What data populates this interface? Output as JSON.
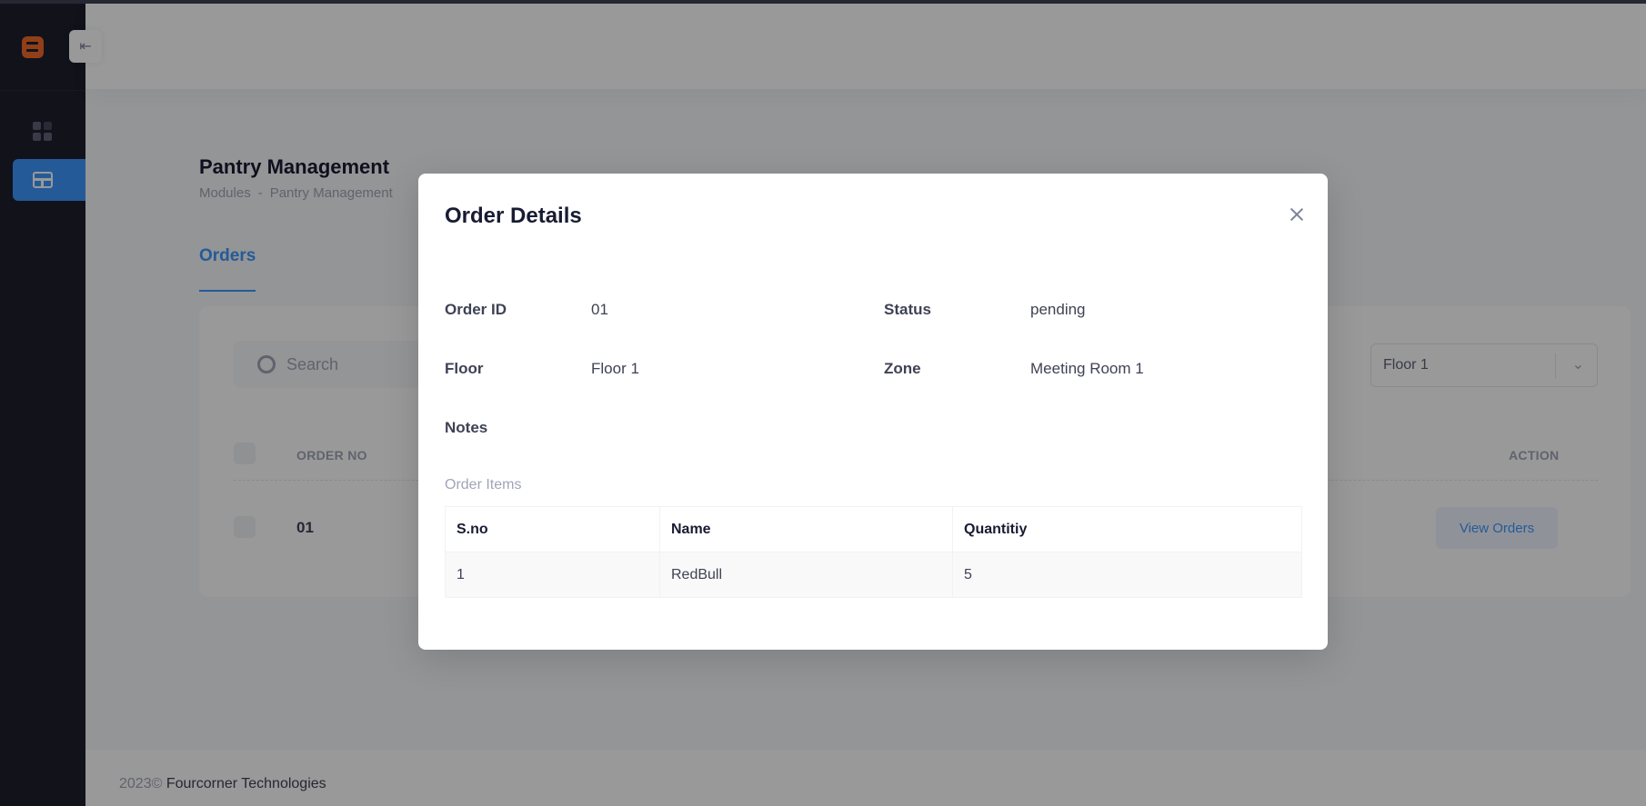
{
  "page": {
    "title": "Pantry Management",
    "breadcrumb": [
      "Modules",
      "-",
      "Pantry Management"
    ],
    "active_tab": "Orders",
    "collapse_icon": "⇤"
  },
  "filters": {
    "search_placeholder": "Search",
    "floor_selected": "Floor 1"
  },
  "table": {
    "columns": [
      "ORDER NO",
      "ACTION"
    ],
    "rows": [
      {
        "order_no": "01",
        "action": "View Orders"
      }
    ]
  },
  "footer": {
    "year": "2023©",
    "company": "Fourcorner Technologies"
  },
  "modal": {
    "title": "Order Details",
    "fields": {
      "order_id": {
        "label": "Order ID",
        "value": "01"
      },
      "status": {
        "label": "Status",
        "value": "pending"
      },
      "floor": {
        "label": "Floor",
        "value": "Floor 1"
      },
      "zone": {
        "label": "Zone",
        "value": "Meeting Room 1"
      },
      "notes": {
        "label": "Notes",
        "value": ""
      }
    },
    "items_label": "Order Items",
    "items_columns": [
      "S.no",
      "Name",
      "Quantitiy"
    ],
    "items": [
      {
        "sno": "1",
        "name": "RedBull",
        "quantity": "5"
      }
    ]
  },
  "colors": {
    "accent": "#3e97ff",
    "sidebar": "#1e1e2d",
    "logo": "#f1692a"
  }
}
